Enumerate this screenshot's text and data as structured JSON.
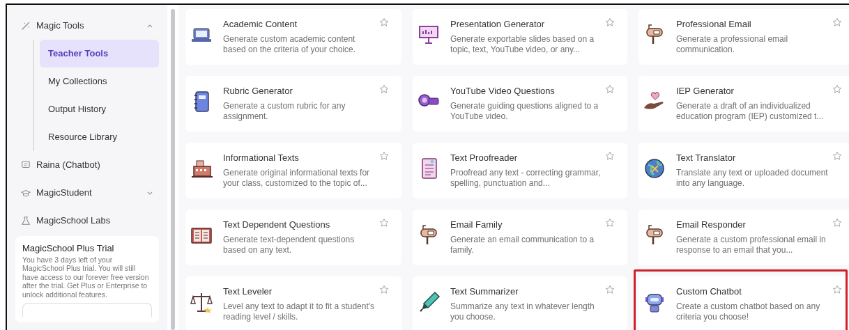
{
  "sidebar": {
    "items": [
      {
        "label": "Magic Tools",
        "kind": "wand",
        "expanded": true,
        "children": [
          {
            "label": "Teacher Tools",
            "selected": true
          },
          {
            "label": "My Collections",
            "selected": false
          },
          {
            "label": "Output History",
            "selected": false
          },
          {
            "label": "Resource Library",
            "selected": false
          }
        ]
      },
      {
        "label": "Raina (Chatbot)",
        "kind": "chat"
      },
      {
        "label": "MagicStudent",
        "kind": "cap",
        "expanded": false
      },
      {
        "label": "MagicSchool Labs",
        "kind": "flask"
      }
    ],
    "trial": {
      "title": "MagicSchool Plus Trial",
      "text": "You have 3 days left of your MagicSchool Plus trial. You will still have access to our forever free version after the trial. Get Plus or Enterprise to unlock additional features."
    }
  },
  "tools": [
    {
      "title": "Academic Content",
      "description": "Generate custom academic content based on the criteria of your choice.",
      "kind": "laptop",
      "highlighted": false
    },
    {
      "title": "Presentation Generator",
      "description": "Generate exportable slides based on a topic, text, YouTube video, or any...",
      "kind": "easel",
      "highlighted": false
    },
    {
      "title": "Professional Email",
      "description": "Generate a professional email communication.",
      "kind": "mailbox",
      "highlighted": false
    },
    {
      "title": "Rubric Generator",
      "description": "Generate a custom rubric for any assignment.",
      "kind": "notebook",
      "highlighted": false
    },
    {
      "title": "YouTube Video Questions",
      "description": "Generate guiding questions aligned to a YouTube video.",
      "kind": "camera",
      "highlighted": false
    },
    {
      "title": "IEP Generator",
      "description": "Generate a draft of an individualized education program (IEP) customized t...",
      "kind": "heart",
      "highlighted": false
    },
    {
      "title": "Informational Texts",
      "description": "Generate original informational texts for your class, customized to the topic of...",
      "kind": "building",
      "highlighted": false
    },
    {
      "title": "Text Proofreader",
      "description": "Proofread any text - correcting grammar, spelling, punctuation and...",
      "kind": "document",
      "highlighted": false
    },
    {
      "title": "Text Translator",
      "description": "Translate any text or uploaded document into any language.",
      "kind": "globe",
      "highlighted": false
    },
    {
      "title": "Text Dependent Questions",
      "description": "Generate text-dependent questions based on any text.",
      "kind": "book",
      "highlighted": false
    },
    {
      "title": "Email Family",
      "description": "Generate an email communication to a family.",
      "kind": "mailbox",
      "highlighted": false
    },
    {
      "title": "Email Responder",
      "description": "Generate a custom professional email in response to an email that you...",
      "kind": "mailbox",
      "highlighted": false
    },
    {
      "title": "Text Leveler",
      "description": "Level any text to adapt it to fit a student's reading level / skills.",
      "kind": "scales",
      "highlighted": false
    },
    {
      "title": "Text Summarizer",
      "description": "Summarize any text in whatever length you choose.",
      "kind": "marker",
      "highlighted": false
    },
    {
      "title": "Custom Chatbot",
      "description": "Create a custom chatbot based on any criteria you choose!",
      "kind": "robot",
      "highlighted": true
    }
  ]
}
